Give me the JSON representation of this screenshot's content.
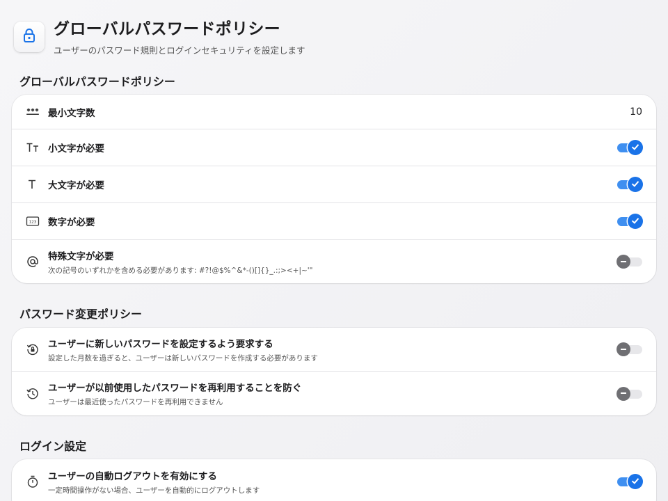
{
  "header": {
    "title": "グローバルパスワードポリシー",
    "subtitle": "ユーザーのパスワード規則とログインセキュリティを設定します",
    "icon": "lock-icon",
    "accent": "#1a73e8"
  },
  "sections": {
    "password_policy": {
      "heading": "グローバルパスワードポリシー",
      "min_length": {
        "label": "最小文字数",
        "value": "10",
        "icon": "dots-icon"
      },
      "lowercase": {
        "label": "小文字が必要",
        "enabled": true,
        "icon": "text-size-icon"
      },
      "uppercase": {
        "label": "大文字が必要",
        "enabled": true,
        "icon": "text-icon"
      },
      "numbers": {
        "label": "数字が必要",
        "enabled": true,
        "icon": "number-pad-icon"
      },
      "special": {
        "label": "特殊文字が必要",
        "desc": "次の記号のいずれかを含める必要があります: #?!@$%^&*-()[]{}_.:;><+|~'\"",
        "enabled": false,
        "icon": "at-sign-icon"
      }
    },
    "change_policy": {
      "heading": "パスワード変更ポリシー",
      "require_new": {
        "label": "ユーザーに新しいパスワードを設定するよう要求する",
        "desc": "設定した月数を過ぎると、ユーザーは新しいパスワードを作成する必要があります",
        "enabled": false,
        "icon": "rotate-lock-icon"
      },
      "prevent_reuse": {
        "label": "ユーザーが以前使用したパスワードを再利用することを防ぐ",
        "desc": "ユーザーは最近使ったパスワードを再利用できません",
        "enabled": false,
        "icon": "history-icon"
      }
    },
    "login": {
      "heading": "ログイン設定",
      "auto_logout": {
        "label": "ユーザーの自動ログアウトを有効にする",
        "desc": "一定時間操作がない場合、ユーザーを自動的にログアウトします",
        "enabled": true,
        "icon": "timer-icon"
      }
    }
  }
}
